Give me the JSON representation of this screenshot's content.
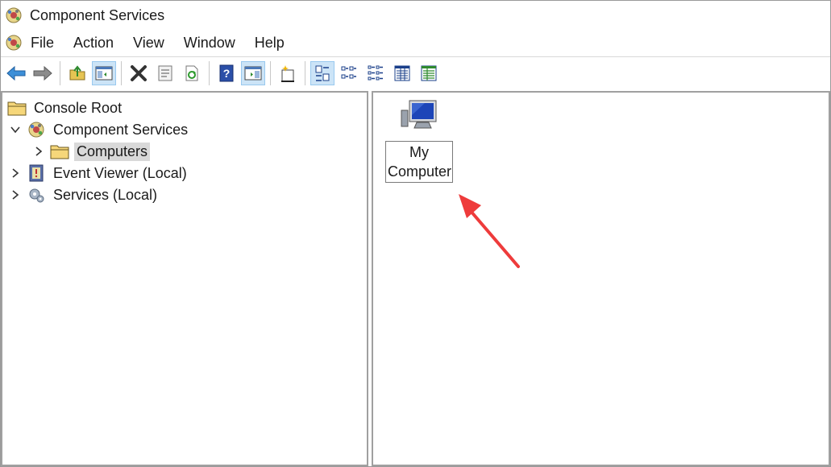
{
  "window": {
    "title": "Component Services"
  },
  "menu": [
    "File",
    "Action",
    "View",
    "Window",
    "Help"
  ],
  "toolbar": {
    "buttons": [
      {
        "icon": "back-arrow-icon",
        "pressed": false
      },
      {
        "icon": "forward-arrow-icon",
        "pressed": false
      },
      {
        "icon": "up-folder-icon",
        "pressed": false
      },
      {
        "icon": "show-hide-tree-icon",
        "pressed": true
      },
      {
        "icon": "delete-icon",
        "pressed": false
      },
      {
        "icon": "properties-icon",
        "pressed": false
      },
      {
        "icon": "refresh-icon",
        "pressed": false
      },
      {
        "icon": "help-icon",
        "pressed": false
      },
      {
        "icon": "show-action-pane-icon",
        "pressed": true
      },
      {
        "icon": "new-window-icon",
        "pressed": false
      },
      {
        "icon": "large-icons-view-icon",
        "pressed": true
      },
      {
        "icon": "small-icons-view-icon",
        "pressed": false
      },
      {
        "icon": "list-view-icon",
        "pressed": false
      },
      {
        "icon": "detail-view-icon",
        "pressed": false
      },
      {
        "icon": "configure-view-icon",
        "pressed": false
      }
    ]
  },
  "tree": {
    "root": "Console Root",
    "items": [
      {
        "label": "Component Services",
        "expanded": true
      },
      {
        "label": "Computers",
        "selected": true
      },
      {
        "label": "Event Viewer (Local)"
      },
      {
        "label": "Services (Local)"
      }
    ]
  },
  "content": {
    "items": [
      {
        "label": "My Computer"
      }
    ]
  },
  "colors": {
    "selection": "#d9d9d9",
    "pressed": "#cce4f7",
    "annotation": "#ee3b3b"
  }
}
